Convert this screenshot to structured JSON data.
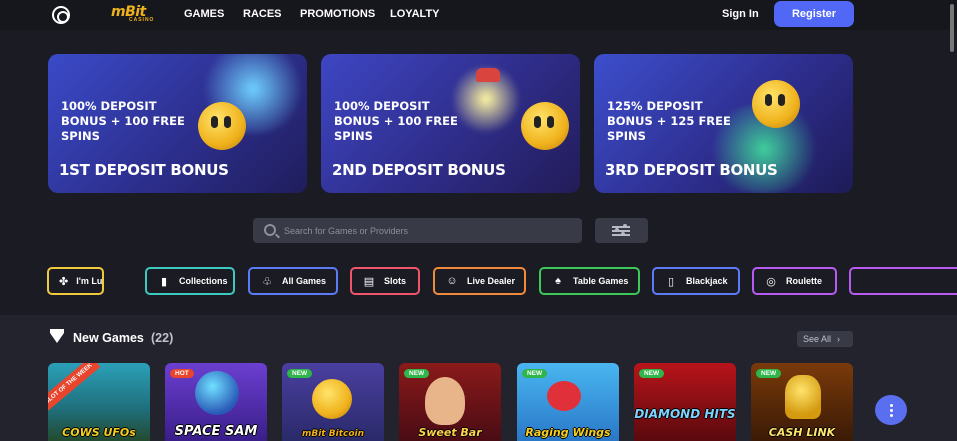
{
  "header": {
    "logo": "mBit",
    "logo_sub": "CASINO",
    "nav": [
      "GAMES",
      "RACES",
      "PROMOTIONS",
      "LOYALTY"
    ],
    "sign_in": "Sign In",
    "register": "Register"
  },
  "banners": [
    {
      "headline": "100% DEPOSIT BONUS + 100 FREE SPINS",
      "title": "1ST DEPOSIT BONUS"
    },
    {
      "headline": "100% DEPOSIT BONUS + 100 FREE SPINS",
      "title": "2ND DEPOSIT BONUS"
    },
    {
      "headline": "125% DEPOSIT BONUS + 125 FREE SPINS",
      "title": "3RD DEPOSIT BONUS"
    }
  ],
  "search": {
    "placeholder": "Search for Games or Providers",
    "value": ""
  },
  "categories": [
    {
      "label": "I'm Lucky",
      "color": "#f0c93d",
      "icon": "clover-icon"
    },
    {
      "label": "Collections",
      "color": "#3cc9c0",
      "icon": "collections-icon"
    },
    {
      "label": "All Games",
      "color": "#5b7cf5",
      "icon": "all-games-icon"
    },
    {
      "label": "Slots",
      "color": "#f0566a",
      "icon": "slots-icon"
    },
    {
      "label": "Live Dealer",
      "color": "#f08a3c",
      "icon": "live-dealer-icon"
    },
    {
      "label": "Table Games",
      "color": "#3cc95a",
      "icon": "table-games-icon"
    },
    {
      "label": "Blackjack",
      "color": "#5b7cf5",
      "icon": "blackjack-icon"
    },
    {
      "label": "Roulette",
      "color": "#b85bf5",
      "icon": "roulette-icon"
    }
  ],
  "new_games": {
    "title": "New Games",
    "count": "(22)",
    "see_all": "See All",
    "games": [
      {
        "name": "COWS UFOs",
        "badge": "SLOT OF THE WEEK",
        "badge_color": "#e8452c"
      },
      {
        "name": "SPACE SAM",
        "badge": "HOT",
        "badge_color": "#e8452c"
      },
      {
        "name": "mBit Bitcoin",
        "badge": "NEW",
        "badge_color": "#2fb54a"
      },
      {
        "name": "Sweet Bar",
        "badge": "NEW",
        "badge_color": "#2fb54a"
      },
      {
        "name": "Raging Wings",
        "badge": "NEW",
        "badge_color": "#2fb54a"
      },
      {
        "name": "DIAMOND HITS",
        "badge": "NEW",
        "badge_color": "#2fb54a"
      },
      {
        "name": "CASH LINK",
        "badge": "NEW",
        "badge_color": "#2fb54a"
      }
    ]
  },
  "colors": {
    "accent": "#5167f5",
    "background": "#1b1b23",
    "logo": "#f0b21c"
  }
}
